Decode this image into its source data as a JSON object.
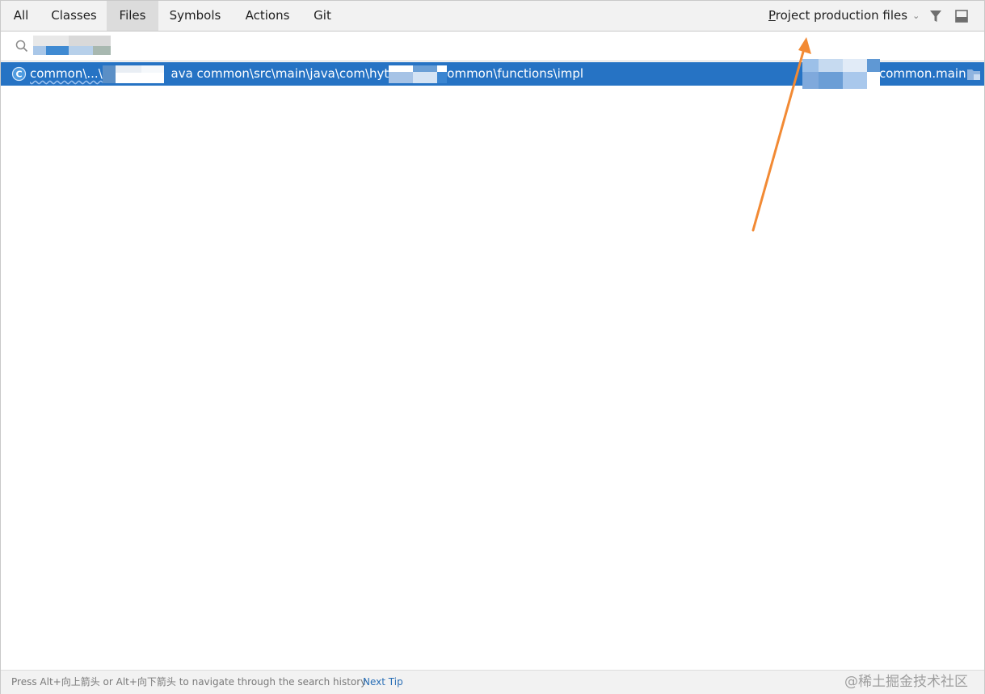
{
  "tabs": [
    {
      "label": "All",
      "active": false
    },
    {
      "label": "Classes",
      "active": false
    },
    {
      "label": "Files",
      "active": true
    },
    {
      "label": "Symbols",
      "active": false
    },
    {
      "label": "Actions",
      "active": false
    },
    {
      "label": "Git",
      "active": false
    }
  ],
  "toolbar": {
    "scope_prefix": "P",
    "scope_rest": "roject production files",
    "scope_dropdown_icon": "chevron-down-icon",
    "filter_icon": "filter-icon",
    "preview_icon": "preview-panel-icon"
  },
  "search": {
    "value": "",
    "placeholder": "",
    "icon": "search-icon"
  },
  "results": [
    {
      "icon": "class-file-icon",
      "path_part_1": "common\\...\\",
      "path_part_2": "ava common\\src\\main\\java\\com\\hyt",
      "path_part_3": "ommon\\functions\\impl",
      "module": "common.main",
      "module_icon": "module-folder-icon"
    }
  ],
  "footer": {
    "hint": "Press Alt+向上箭头 or Alt+向下箭头 to navigate through the search history",
    "next_tip": "Next Tip",
    "watermark": "@稀土掘金技术社区"
  },
  "colors": {
    "selection": "#2673c4",
    "annotation_arrow": "#f28a34",
    "link": "#2a6fb6"
  }
}
